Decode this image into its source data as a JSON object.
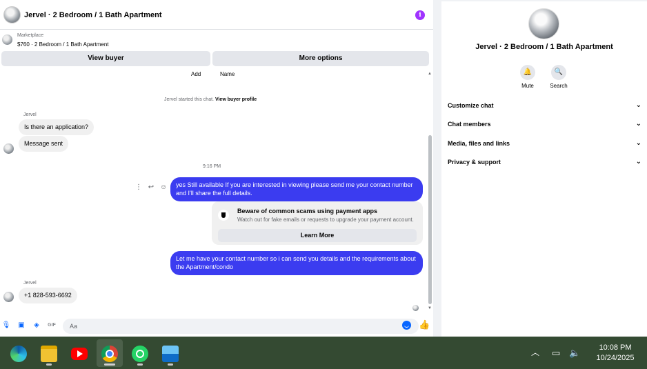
{
  "chat": {
    "title": "Jervel · 2 Bedroom / 1 Bath Apartment",
    "listing_source": "Marketplace",
    "listing_detail": "$760 · 2 Bedroom / 1 Bath Apartment",
    "view_buyer_label": "View buyer",
    "more_options_label": "More options",
    "add_label": "Add",
    "name_label": "Name",
    "started_text": "Jervel started this chat.",
    "view_buyer_profile_label": "View buyer profile",
    "sender_name": "Jervel",
    "msg_1": "Is there an application?",
    "msg_2": "Message sent",
    "timestamp": "9:16 PM",
    "out_msg_1": "yes Still available If you are interested in viewing please send me your contact number and I'll share the full details.",
    "warning_title": "Beware of common scams using payment apps",
    "warning_sub": "Watch out for fake emails or requests to upgrade your payment account.",
    "learn_more_label": "Learn More",
    "out_msg_2": "Let me have your contact number so i can send you details and the requirements about the Apartment/condo",
    "sender_name_2": "Jervel",
    "msg_3": "+1 828-593-6692",
    "input_placeholder": "Aa"
  },
  "info": {
    "name": "Jervel · 2 Bedroom / 1 Bath Apartment",
    "mute_label": "Mute",
    "search_label": "Search",
    "sections": [
      {
        "label": "Customize chat"
      },
      {
        "label": "Chat members"
      },
      {
        "label": "Media, files and links"
      },
      {
        "label": "Privacy & support"
      }
    ]
  },
  "taskbar": {
    "apps": [
      "edge-icon",
      "file-explorer-icon",
      "youtube-icon",
      "chrome-icon",
      "whatsapp-icon",
      "photos-icon"
    ],
    "time": "10:08 PM",
    "date": "10/24/2025"
  },
  "colors": {
    "accent": "#0866ff",
    "outgoing_bubble": "#3b3cf0",
    "taskbar": "#344a32"
  }
}
